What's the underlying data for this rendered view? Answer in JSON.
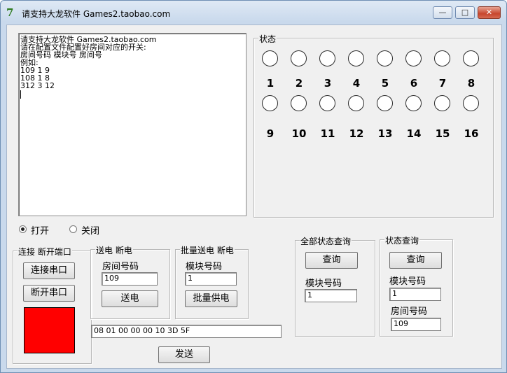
{
  "window": {
    "title": "请支持大龙软件 Games2.taobao.com",
    "icon": "app-logo-icon",
    "minimize": "—",
    "maximize": "□",
    "close": "✕"
  },
  "log": {
    "lines": [
      "请支持大龙软件 Games2.taobao.com",
      "请在配置文件配置好房间对应的开关:",
      "房间号码 模块号 房间号",
      "例如:",
      "109 1 9",
      "108 1 8",
      "312 3 12"
    ]
  },
  "status_panel": {
    "label": "状态",
    "row1": [
      "1",
      "2",
      "3",
      "4",
      "5",
      "6",
      "7",
      "8"
    ],
    "row2": [
      "9",
      "10",
      "11",
      "12",
      "13",
      "14",
      "15",
      "16"
    ]
  },
  "power_mode": {
    "open_label": "打开",
    "close_label": "关闭",
    "selected": "打开"
  },
  "port_group": {
    "label": "连接 断开端口",
    "connect_button": "连接串口",
    "disconnect_button": "断开串口",
    "indicator_color": "#ff0000"
  },
  "power_group": {
    "label": "送电 断电",
    "room_label": "房间号码",
    "room_value": "109",
    "send_button": "送电"
  },
  "batch_group": {
    "label": "批量送电 断电",
    "module_label": "模块号码",
    "module_value": "1",
    "batch_button": "批量供电"
  },
  "query_all_group": {
    "label": "全部状态查询",
    "query_button": "查询",
    "module_label": "模块号码",
    "module_value": "1"
  },
  "query_group": {
    "label": "状态查询",
    "query_button": "查询",
    "module_label": "模块号码",
    "module_value": "1",
    "room_label": "房间号码",
    "room_value": "109"
  },
  "command": {
    "hex_value": "08 01 00 00 00 10 3D 5F",
    "send_button": "发送"
  }
}
